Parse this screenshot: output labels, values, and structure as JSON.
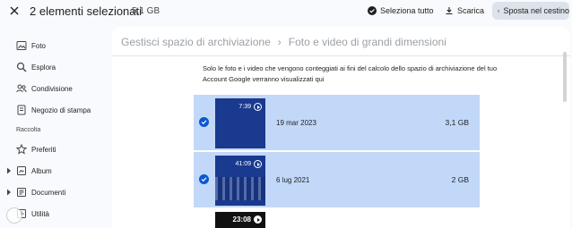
{
  "selection_bar": {
    "title": "2 elementi selezionati",
    "total_size": "5,1 GB",
    "actions": {
      "select_all": "Seleziona tutto",
      "download": "Scarica",
      "move_to_trash": "Sposta nel cestino"
    }
  },
  "sidebar": {
    "items": [
      {
        "label": "Foto",
        "icon": "photo-icon"
      },
      {
        "label": "Esplora",
        "icon": "search-icon"
      },
      {
        "label": "Condivisione",
        "icon": "people-icon"
      },
      {
        "label": "Negozio di stampa",
        "icon": "print-store-icon"
      }
    ],
    "section_label": "Raccolta",
    "collection_items": [
      {
        "label": "Preferiti",
        "icon": "star-icon"
      },
      {
        "label": "Album",
        "icon": "album-icon"
      },
      {
        "label": "Documenti",
        "icon": "document-icon"
      },
      {
        "label": "Utilità",
        "icon": "utilities-icon"
      }
    ]
  },
  "main": {
    "breadcrumb": {
      "parent": "Gestisci spazio di archiviazione",
      "current": "Foto e video di grandi dimensioni"
    },
    "description": "Solo le foto e i video che vengono conteggiati ai fini del calcolo dello spazio di archiviazione del tuo Account Google verranno visualizzati qui",
    "items": [
      {
        "duration": "7:39",
        "date": "19 mar 2023",
        "size": "3,1 GB",
        "selected": true
      },
      {
        "duration": "41:09",
        "date": "6 lug 2021",
        "size": "2 GB",
        "selected": true
      },
      {
        "duration": "23:08"
      }
    ]
  },
  "colors": {
    "accent": "#0b57d0",
    "selected_row": "#c2d8f8",
    "page_bg": "#f8fafd"
  }
}
